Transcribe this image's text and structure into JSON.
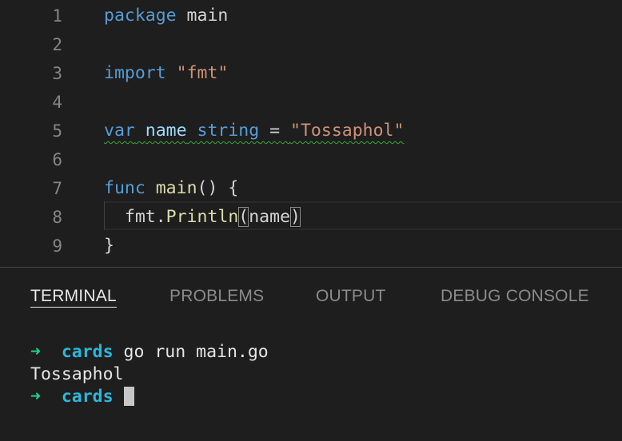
{
  "editor": {
    "lines": [
      {
        "n": "1",
        "tokens": [
          {
            "t": "package",
            "c": "kw"
          },
          {
            "t": " main",
            "c": "plain"
          }
        ]
      },
      {
        "n": "2",
        "tokens": []
      },
      {
        "n": "3",
        "tokens": [
          {
            "t": "import",
            "c": "kw"
          },
          {
            "t": " ",
            "c": "plain"
          },
          {
            "t": "\"fmt\"",
            "c": "str"
          }
        ]
      },
      {
        "n": "4",
        "tokens": []
      },
      {
        "n": "5",
        "tokens": [
          {
            "t": "var",
            "c": "kw"
          },
          {
            "t": " ",
            "c": "plain"
          },
          {
            "t": "name",
            "c": "ident"
          },
          {
            "t": " ",
            "c": "plain"
          },
          {
            "t": "string",
            "c": "kw"
          },
          {
            "t": " = ",
            "c": "plain"
          },
          {
            "t": "\"Tossaphol\"",
            "c": "str"
          }
        ],
        "squiggle": true
      },
      {
        "n": "6",
        "tokens": []
      },
      {
        "n": "7",
        "tokens": [
          {
            "t": "func",
            "c": "kw"
          },
          {
            "t": " ",
            "c": "plain"
          },
          {
            "t": "main",
            "c": "fn"
          },
          {
            "t": "() {",
            "c": "plain"
          }
        ]
      },
      {
        "n": "8",
        "tokens": [
          {
            "t": "  fmt.",
            "c": "plain"
          },
          {
            "t": "Println",
            "c": "fn"
          },
          {
            "t": "(",
            "c": "plain",
            "match": true
          },
          {
            "t": "name",
            "c": "plain"
          },
          {
            "t": ")",
            "c": "plain",
            "match": true
          }
        ]
      },
      {
        "n": "9",
        "tokens": [
          {
            "t": "}",
            "c": "plain"
          }
        ]
      }
    ]
  },
  "panel": {
    "tabs": [
      {
        "label": "TERMINAL",
        "active": true
      },
      {
        "label": "PROBLEMS",
        "active": false
      },
      {
        "label": "OUTPUT",
        "active": false
      },
      {
        "label": "DEBUG CONSOLE",
        "active": false
      }
    ],
    "terminal": {
      "prompt_arrow": "➜",
      "cwd": "cards",
      "command": "go run main.go",
      "output": "Tossaphol"
    }
  },
  "colors": {
    "background": "#1e1e1e",
    "keyword": "#569cd6",
    "string": "#ce9178",
    "function": "#dcdcaa",
    "identifier": "#9cdcfe",
    "prompt_arrow": "#23d18b",
    "prompt_dir": "#29b8db",
    "warning_squiggle": "#3ca53c"
  }
}
